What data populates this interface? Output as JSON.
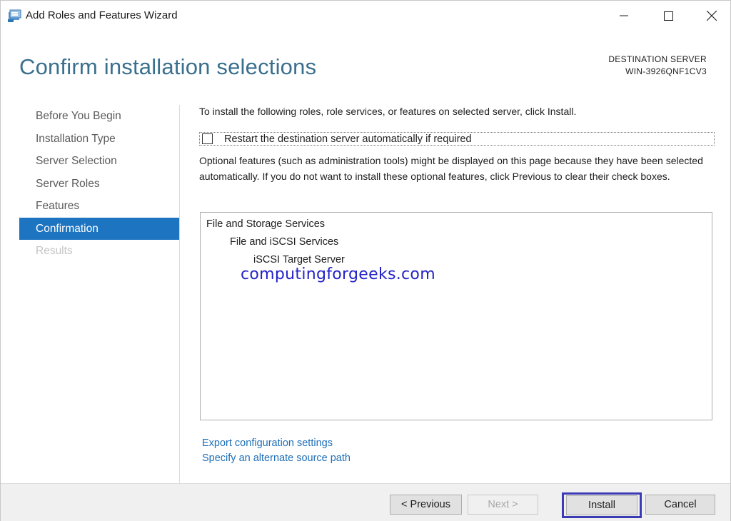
{
  "window": {
    "title": "Add Roles and Features Wizard",
    "controls": {
      "minimize": "minimize",
      "maximize": "maximize",
      "close": "close"
    }
  },
  "header": {
    "title": "Confirm installation selections",
    "destination_label": "DESTINATION SERVER",
    "destination_server": "WIN-3926QNF1CV3"
  },
  "nav": {
    "items": [
      {
        "label": "Before You Begin",
        "state": "normal"
      },
      {
        "label": "Installation Type",
        "state": "normal"
      },
      {
        "label": "Server Selection",
        "state": "normal"
      },
      {
        "label": "Server Roles",
        "state": "normal"
      },
      {
        "label": "Features",
        "state": "normal"
      },
      {
        "label": "Confirmation",
        "state": "active"
      },
      {
        "label": "Results",
        "state": "disabled"
      }
    ]
  },
  "content": {
    "intro": "To install the following roles, role services, or features on selected server, click Install.",
    "restart_label": "Restart the destination server automatically if required",
    "restart_checked": false,
    "optional_note": "Optional features (such as administration tools) might be displayed on this page because they have been selected automatically. If you do not want to install these optional features, click Previous to clear their check boxes.",
    "selections": [
      {
        "label": "File and Storage Services",
        "level": 0
      },
      {
        "label": "File and iSCSI Services",
        "level": 1
      },
      {
        "label": "iSCSI Target Server",
        "level": 2
      }
    ],
    "watermark": "computingforgeeks.com",
    "links": {
      "export": "Export configuration settings",
      "alternate_source": "Specify an alternate source path"
    }
  },
  "footer": {
    "previous": "< Previous",
    "next": "Next >",
    "install": "Install",
    "cancel": "Cancel"
  },
  "colors": {
    "title": "#3a6f8e",
    "nav_active_bg": "#1d74c0",
    "link": "#1e6fb8",
    "watermark": "#2323c8"
  }
}
